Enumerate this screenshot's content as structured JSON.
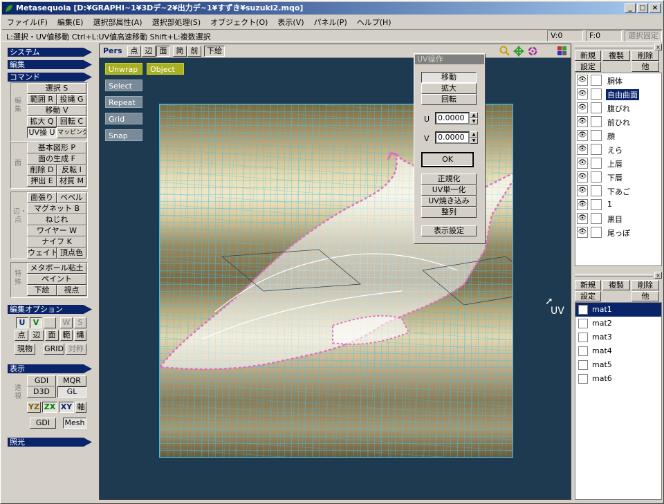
{
  "window": {
    "title": "Metasequoia [D:¥GRAPHI~1¥3Dデ~2¥出力デ~1¥すずき¥suzuki2.mqo]",
    "app_icon": "leaf-icon",
    "minimize": "_",
    "maximize": "□",
    "close": "×"
  },
  "menu": [
    "ファイル(F)",
    "編集(E)",
    "選択部属性(A)",
    "選択部処理(S)",
    "オブジェクト(O)",
    "表示(V)",
    "パネル(P)",
    "ヘルプ(H)"
  ],
  "status": {
    "hint": "L:選択・UV値移動  Ctrl+L:UV値高速移動  Shift+L:複数選択",
    "vertex_count": "V:0",
    "face_count": "F:0",
    "fix_selection": "選択固定"
  },
  "left_panel": {
    "system": "システム",
    "edit": "編集",
    "command": "コマンド",
    "group_edit": "編集",
    "group_face": "面",
    "group_edge": "辺・点",
    "group_special": "特殊",
    "btn_select": "選択 S",
    "btn_range": "範囲 R",
    "btn_lasso": "投縄 G",
    "btn_move": "移動 V",
    "btn_scale": "拡大 Q",
    "btn_rotate": "回転 C",
    "btn_uv": "UV操 U",
    "btn_mapping": "マッピング",
    "btn_primitive": "基本図形 P",
    "btn_create_face": "面の生成 F",
    "btn_delete": "削除 D",
    "btn_flip": "反転 I",
    "btn_extrude": "押出 E",
    "btn_material": "材質 M",
    "btn_stretch": "面張り",
    "btn_bevel": "ベベル",
    "btn_magnet": "マグネット B",
    "btn_twist": "ねじれ",
    "btn_wire": "ワイヤー W",
    "btn_knife": "ナイフ K",
    "btn_weight": "ウェイト",
    "btn_vcolor": "頂点色",
    "btn_metaball": "メタボール粘土",
    "btn_paint": "ペイント",
    "btn_underlay": "下絵",
    "btn_viewpoint": "視点",
    "edit_options": "編集オプション",
    "opt_u": "U",
    "opt_v": "V",
    "opt_w": "W",
    "opt_s": "S",
    "opt_point": "点",
    "opt_edge": "辺",
    "opt_face": "面",
    "opt_range": "範",
    "opt_rope": "縄",
    "opt_current": "現物",
    "opt_grid": "GRID",
    "opt_sym": "対称",
    "display": "表示",
    "disp_transparent": "透視",
    "disp_gdi": "GDI",
    "disp_mqr": "MQR",
    "disp_d3d": "D3D",
    "disp_gl": "GL",
    "disp_yz": "YZ",
    "disp_zx": "ZX",
    "disp_xy": "XY",
    "disp_axis": "軸",
    "disp_gdi2": "GDI",
    "disp_mesh": "Mesh",
    "lighting": "照光"
  },
  "viewport": {
    "pers": "Pers",
    "point": "点",
    "edge": "辺",
    "face": "面",
    "simple": "简",
    "front": "前",
    "underlay": "下絵",
    "zoom_icon": "magnifier-icon",
    "move_icon": "move-arrows-icon",
    "rotate_icon": "rotate-icon",
    "grid_icon": "quad-view-icon",
    "unwrap": "Unwrap",
    "object": "Object",
    "select": "Select",
    "repeat": "Repeat",
    "grid": "Grid",
    "snap": "Snap",
    "uv_label": "UV",
    "colors": {
      "bg": "#1e3a50",
      "wire": "#47c0e0",
      "vertex": "#e070c0",
      "accent": "#a8b020"
    }
  },
  "uv_dialog": {
    "title": "UV操作",
    "move": "移動",
    "scale": "拡大",
    "rotate": "回転",
    "u_label": "U",
    "u_value": "0.0000",
    "v_label": "V",
    "v_value": "0.0000",
    "ok": "OK",
    "normalize": "正規化",
    "uv_unify": "UV単一化",
    "uv_bake": "UV焼き込み",
    "align": "整列",
    "display_settings": "表示設定"
  },
  "object_panel": {
    "new": "新規",
    "dup": "複製",
    "del": "削除",
    "settings": "設定",
    "other": "他",
    "objects": [
      "胴体",
      "自由曲面",
      "腹びれ",
      "前ひれ",
      "顔",
      "えら",
      "上唇",
      "下唇",
      "下あご",
      "1",
      "黒目",
      "尾っぽ"
    ],
    "selected": "自由曲面"
  },
  "material_panel": {
    "new": "新規",
    "dup": "複製",
    "del": "削除",
    "settings": "設定",
    "other": "他",
    "materials": [
      "mat1",
      "mat2",
      "mat3",
      "mat4",
      "mat5",
      "mat6"
    ],
    "selected": "mat1"
  }
}
